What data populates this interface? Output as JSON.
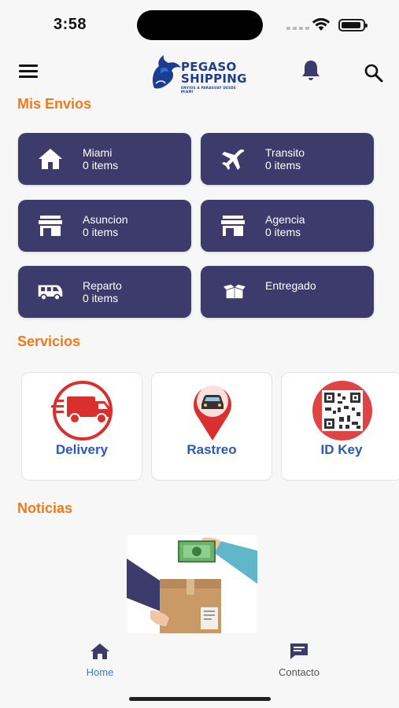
{
  "status_bar": {
    "time": "3:58"
  },
  "header": {
    "logo_line1": "PEGASO",
    "logo_line2": "SHIPPING",
    "logo_tagline": "ENVIOS A PARAGUAY DESDE MIAMI"
  },
  "sections": {
    "shipments_title": "Mis Envios",
    "services_title": "Servicios",
    "news_title": "Noticias"
  },
  "shipments": [
    {
      "name": "Miami",
      "count": "0 items",
      "icon": "house-icon"
    },
    {
      "name": "Transito",
      "count": "0 items",
      "icon": "airplane-icon"
    },
    {
      "name": "Asuncion",
      "count": "0 items",
      "icon": "store-icon"
    },
    {
      "name": "Agencia",
      "count": "0 items",
      "icon": "store-icon"
    },
    {
      "name": "Reparto",
      "count": "0 items",
      "icon": "van-icon"
    },
    {
      "name": "Entregado",
      "icon": "open-box-icon"
    }
  ],
  "services": [
    {
      "label": "Delivery",
      "icon": "delivery-truck-icon"
    },
    {
      "label": "Rastreo",
      "icon": "location-car-icon"
    },
    {
      "label": "ID Key",
      "icon": "qr-code-icon"
    }
  ],
  "bottom_nav": [
    {
      "label": "Home",
      "icon": "home-icon",
      "active": true
    },
    {
      "label": "Contacto",
      "icon": "chat-icon",
      "active": false
    }
  ],
  "colors": {
    "accent": "#f07a1a",
    "card_bg": "#3c3b6c",
    "service_label": "#2d58b8",
    "nav_active": "#3a7bd5",
    "icon_red": "#d9302f"
  }
}
